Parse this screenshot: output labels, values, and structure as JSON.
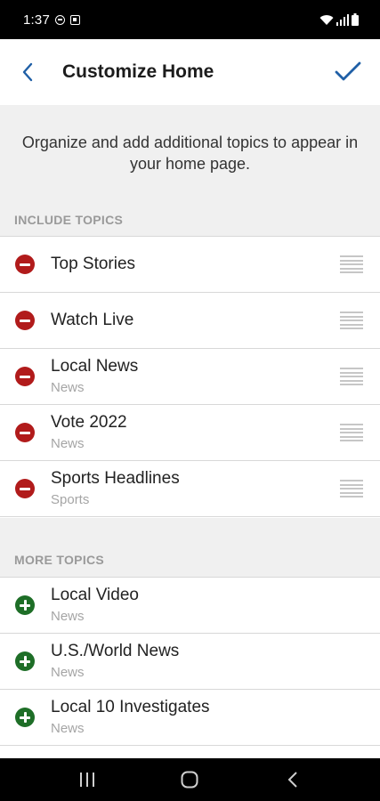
{
  "status": {
    "time": "1:37"
  },
  "header": {
    "title": "Customize Home",
    "back_icon": "chevron-left-icon",
    "done_icon": "check-icon",
    "accent": "#1f5fa6"
  },
  "intro": "Organize and add additional topics to appear in your home page.",
  "include": {
    "label": "INCLUDE TOPICS",
    "items": [
      {
        "title": "Top Stories",
        "sub": ""
      },
      {
        "title": "Watch Live",
        "sub": ""
      },
      {
        "title": "Local News",
        "sub": "News"
      },
      {
        "title": "Vote 2022",
        "sub": "News"
      },
      {
        "title": "Sports Headlines",
        "sub": "Sports"
      }
    ]
  },
  "more": {
    "label": "MORE TOPICS",
    "items": [
      {
        "title": "Local Video",
        "sub": "News"
      },
      {
        "title": "U.S./World News",
        "sub": "News"
      },
      {
        "title": "Local 10 Investigates",
        "sub": "News"
      }
    ]
  },
  "colors": {
    "remove": "#b11b1b",
    "add": "#1e6e27"
  }
}
